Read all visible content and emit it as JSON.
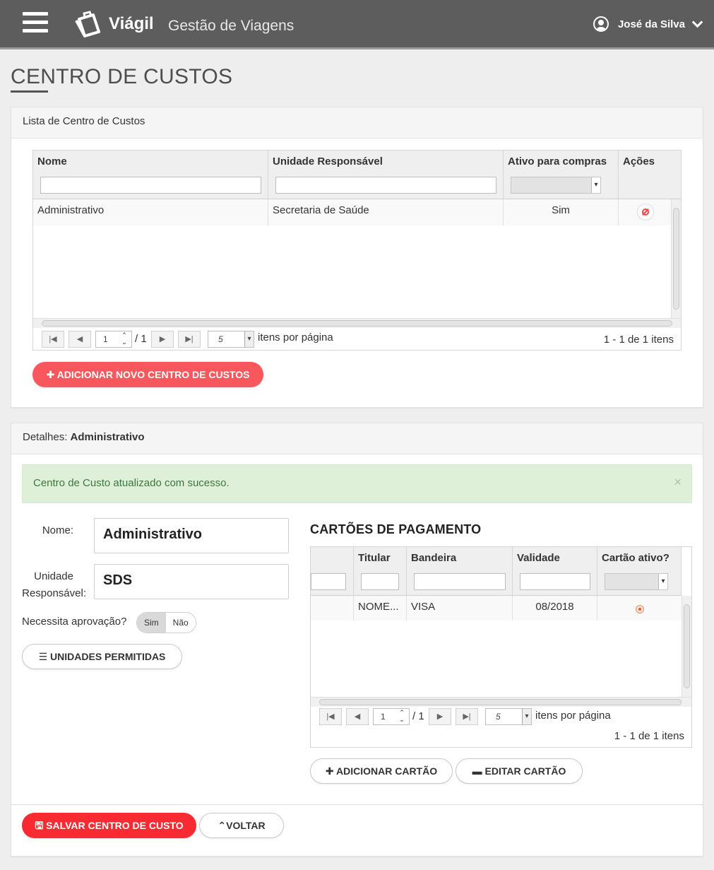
{
  "header": {
    "brand": "Viágil",
    "app_title": "Gestão de Viagens",
    "user_name": "José da Silva"
  },
  "page": {
    "title": "CENTRO DE CUSTOS"
  },
  "list_panel": {
    "heading": "Lista de Centro de Custos",
    "columns": [
      "Nome",
      "Unidade Responsável",
      "Ativo para compras",
      "Ações"
    ],
    "rows": [
      {
        "nome": "Administrativo",
        "unidade": "Secretaria de Saúde",
        "ativo": "Sim"
      }
    ],
    "pager": {
      "page": "1",
      "of": "/ 1",
      "size": "5",
      "per_page": "itens por página",
      "summary": "1 - 1 de 1 itens"
    },
    "add_button": "ADICIONAR NOVO CENTRO DE CUSTOS"
  },
  "detail_panel": {
    "heading_prefix": "Detalhes:",
    "heading_name": "Administrativo",
    "alert": "Centro de Custo atualizado com sucesso.",
    "alert_close": "×",
    "fields": {
      "nome_label": "Nome:",
      "nome_value": "Administrativo",
      "unidade_label_1": "Unidade",
      "unidade_label_2": "Responsável:",
      "unidade_value": "SDS",
      "aprovacao_label": "Necessita aprovação?",
      "toggle_sim": "Sim",
      "toggle_nao": "Não"
    },
    "unidades_button": "UNIDADES PERMITIDAS",
    "cards": {
      "title": "CARTÕES DE PAGAMENTO",
      "columns": [
        "",
        "Titular",
        "Bandeira",
        "Validade",
        "Cartão ativo?"
      ],
      "rows": [
        {
          "col0": "",
          "titular": "NOME...",
          "bandeira": "VISA",
          "validade": "08/2018"
        }
      ],
      "pager": {
        "page": "1",
        "of": "/ 1",
        "size": "5",
        "per_page": "itens por página",
        "summary": "1 - 1 de 1 itens"
      },
      "add_button": "ADICIONAR CARTÃO",
      "edit_button": "EDITAR CARTÃO"
    },
    "save_button": "SALVAR CENTRO DE CUSTO",
    "back_button": "VOLTAR"
  },
  "colors": {
    "accent_red": "#f7575d",
    "save_red": "#fa2a32",
    "topbar": "#5d5d5d",
    "success_bg": "#dff0d8"
  }
}
